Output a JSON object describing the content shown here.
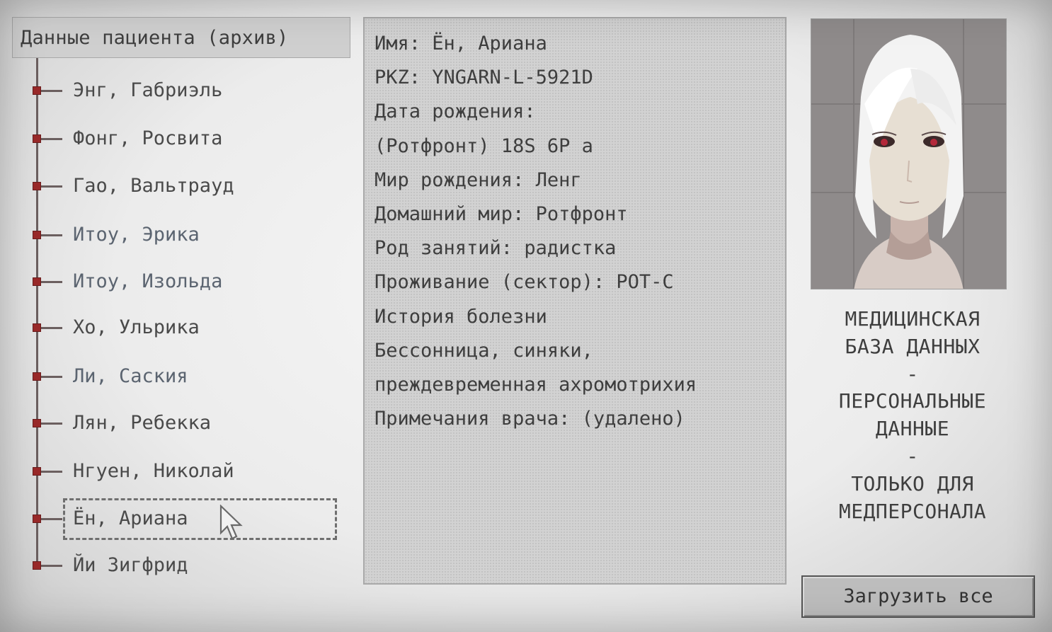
{
  "sidebar": {
    "title": "Данные пациента (архив)",
    "patients": [
      {
        "label": "Энг, Габриэль"
      },
      {
        "label": "Фонг, Росвита"
      },
      {
        "label": "Гао, Вальтрауд"
      },
      {
        "label": "Итоу, Эрика"
      },
      {
        "label": "Итоу, Изольда"
      },
      {
        "label": "Хо, Ульрика"
      },
      {
        "label": "Ли, Саския"
      },
      {
        "label": "Лян, Ребекка"
      },
      {
        "label": "Нгуен, Николай"
      },
      {
        "label": "Ён, Ариана"
      },
      {
        "label": "Йи Зигфрид"
      }
    ],
    "selected": "Ён, Ариана"
  },
  "record": {
    "lines": [
      "Имя: Ён, Ариана",
      "PKZ: YNGARN-L-5921D",
      "Дата рождения:",
      "(Ротфронт) 18S 6P а",
      "Мир рождения: Ленг",
      "Домашний мир: Ротфронт",
      "Род занятий: радистка",
      "Проживание (сектор): POT-C",
      "История болезни",
      "Бессонница, синяки,",
      "преждевременная ахромотрихия",
      "Примечания врача: (удалено)"
    ]
  },
  "caption": {
    "lines": [
      "МЕДИЦИНСКАЯ",
      "БАЗА ДАННЫХ",
      "-",
      "ПЕРСОНАЛЬНЫЕ",
      "ДАННЫЕ",
      "-",
      "ТОЛЬКО ДЛЯ",
      "МЕДПЕРСОНАЛА"
    ]
  },
  "actions": {
    "load_all_label": "Загрузить все"
  },
  "colors": {
    "node": "#9a2a2a",
    "panel": "#d2d2d2",
    "button": "#bdbdbd"
  }
}
